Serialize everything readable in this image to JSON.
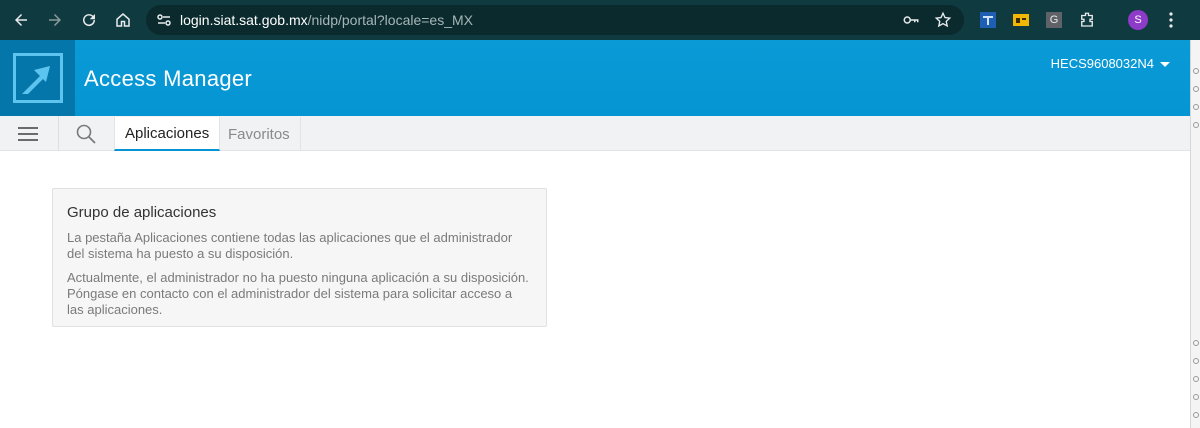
{
  "browser": {
    "url_host": "login.siat.sat.gob.mx",
    "url_path": "/nidp/portal?locale=es_MX",
    "profile_initial": "S",
    "ext_g_label": "G"
  },
  "header": {
    "title": "Access Manager",
    "user": "HECS9608032N4"
  },
  "tabs": [
    {
      "label": "Aplicaciones"
    },
    {
      "label": "Favoritos"
    }
  ],
  "card": {
    "title": "Grupo de aplicaciones",
    "paragraph1": "La pestaña Aplicaciones contiene todas las aplicaciones que el administrador del sistema ha puesto a su disposición.",
    "paragraph2": "Actualmente, el administrador no ha puesto ninguna aplicación a su disposición. Póngase en contacto con el administrador del sistema para solicitar acceso a las aplicaciones."
  },
  "colors": {
    "header_blue": "#0595d3",
    "logo_blue": "#0576a9",
    "chrome_bg": "#0f3a3f"
  }
}
